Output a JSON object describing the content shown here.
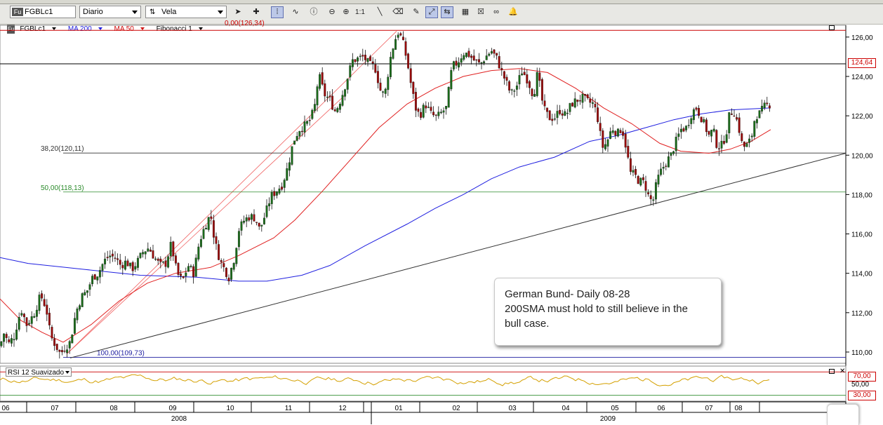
{
  "toolbar": {
    "symbol": "FGBLc1",
    "symbol_badge": "Fu",
    "interval": "Diario",
    "chart_type": "Vela",
    "ratio_label": "1:1"
  },
  "legend": {
    "symbol": "FGBLc1",
    "ma200": "MA 200",
    "ma50": "MA 50",
    "fib": "Fibonacci 1"
  },
  "price_axis": {
    "labels": [
      "126,00",
      "124,00",
      "122,00",
      "120,00",
      "118,00",
      "116,00",
      "114,00",
      "112,00",
      "110,00"
    ],
    "current_price": "124,64"
  },
  "fibonacci": {
    "l382": "38,20(120,11)",
    "l50": "50,00(118,13)",
    "l100": "100,00(109,73)",
    "l0_partial": "0,00(126,34)"
  },
  "rsi": {
    "label": "RSI 12 Suavizado",
    "upper": "70,00",
    "middle": "50,00",
    "lower": "30,00"
  },
  "time_axis": {
    "months": [
      "06",
      "07",
      "08",
      "09",
      "10",
      "11",
      "12",
      "01",
      "02",
      "03",
      "04",
      "05",
      "06",
      "07",
      "08"
    ],
    "years": [
      "2008",
      "2009"
    ]
  },
  "annotation": {
    "line1": "German Bund- Daily 08-28",
    "line2": "200SMA must hold to still believe in the",
    "line3": "bull case."
  },
  "colors": {
    "ma200": "#1f1fe0",
    "ma50": "#e02020",
    "rsi": "#d4a000",
    "up_candle": "#1a6b1a",
    "down_candle": "#9a0a0a"
  },
  "chart_data": {
    "type": "candlestick",
    "y_axis": {
      "range": [
        109.5,
        126.6
      ],
      "ticks": [
        110,
        112,
        114,
        116,
        118,
        120,
        122,
        124,
        126
      ]
    },
    "x_axis": {
      "months": [
        "06",
        "07",
        "08",
        "09",
        "10",
        "11",
        "12",
        "01",
        "02",
        "03",
        "04",
        "05",
        "06",
        "07",
        "08"
      ],
      "years": [
        "2008",
        "2009"
      ]
    },
    "close_path": [
      [
        0,
        110.3
      ],
      [
        6,
        111.0
      ],
      [
        12,
        110.4
      ],
      [
        20,
        110.8
      ],
      [
        30,
        112.2
      ],
      [
        38,
        111.4
      ],
      [
        48,
        111.9
      ],
      [
        58,
        112.9
      ],
      [
        66,
        112.2
      ],
      [
        72,
        110.8
      ],
      [
        80,
        110.3
      ],
      [
        86,
        109.9
      ],
      [
        92,
        110.2
      ],
      [
        100,
        110.5
      ],
      [
        108,
        112.0
      ],
      [
        116,
        112.8
      ],
      [
        124,
        113.1
      ],
      [
        132,
        113.8
      ],
      [
        140,
        114.0
      ],
      [
        148,
        114.6
      ],
      [
        156,
        114.9
      ],
      [
        164,
        114.8
      ],
      [
        172,
        114.4
      ],
      [
        180,
        114.6
      ],
      [
        188,
        114.2
      ],
      [
        196,
        114.6
      ],
      [
        204,
        115.1
      ],
      [
        212,
        115.3
      ],
      [
        220,
        114.8
      ],
      [
        228,
        114.4
      ],
      [
        236,
        114.5
      ],
      [
        244,
        115.5
      ],
      [
        252,
        114.0
      ],
      [
        260,
        113.6
      ],
      [
        268,
        114.4
      ],
      [
        276,
        114.0
      ],
      [
        284,
        115.6
      ],
      [
        292,
        116.4
      ],
      [
        300,
        117.0
      ],
      [
        306,
        115.6
      ],
      [
        314,
        114.6
      ],
      [
        320,
        114.2
      ],
      [
        326,
        113.8
      ],
      [
        334,
        114.8
      ],
      [
        340,
        116.2
      ],
      [
        348,
        116.7
      ],
      [
        356,
        116.9
      ],
      [
        364,
        116.8
      ],
      [
        370,
        116.2
      ],
      [
        378,
        117.0
      ],
      [
        386,
        117.9
      ],
      [
        394,
        118.2
      ],
      [
        402,
        118.5
      ],
      [
        410,
        119.4
      ],
      [
        418,
        120.7
      ],
      [
        426,
        121.3
      ],
      [
        434,
        121.5
      ],
      [
        442,
        121.8
      ],
      [
        448,
        122.4
      ],
      [
        454,
        124.1
      ],
      [
        462,
        123.1
      ],
      [
        470,
        122.8
      ],
      [
        478,
        122.2
      ],
      [
        486,
        122.9
      ],
      [
        494,
        123.8
      ],
      [
        502,
        124.8
      ],
      [
        510,
        124.9
      ],
      [
        518,
        125.0
      ],
      [
        526,
        124.6
      ],
      [
        534,
        124.5
      ],
      [
        542,
        123.3
      ],
      [
        548,
        123.0
      ],
      [
        556,
        124.9
      ],
      [
        562,
        125.8
      ],
      [
        568,
        126.3
      ],
      [
        574,
        125.7
      ],
      [
        580,
        124.8
      ],
      [
        586,
        123.5
      ],
      [
        592,
        122.4
      ],
      [
        598,
        122.0
      ],
      [
        606,
        122.6
      ],
      [
        614,
        122.1
      ],
      [
        622,
        121.9
      ],
      [
        630,
        122.2
      ],
      [
        636,
        122.4
      ],
      [
        644,
        124.5
      ],
      [
        652,
        124.7
      ],
      [
        660,
        125.2
      ],
      [
        668,
        125.1
      ],
      [
        676,
        124.8
      ],
      [
        684,
        124.6
      ],
      [
        692,
        125.0
      ],
      [
        700,
        125.3
      ],
      [
        708,
        124.9
      ],
      [
        714,
        124.3
      ],
      [
        720,
        123.8
      ],
      [
        728,
        123.1
      ],
      [
        736,
        123.5
      ],
      [
        744,
        124.3
      ],
      [
        752,
        123.8
      ],
      [
        760,
        123.0
      ],
      [
        766,
        124.2
      ],
      [
        774,
        122.4
      ],
      [
        782,
        121.9
      ],
      [
        790,
        121.9
      ],
      [
        798,
        122.3
      ],
      [
        806,
        122.0
      ],
      [
        814,
        122.6
      ],
      [
        822,
        122.8
      ],
      [
        830,
        122.9
      ],
      [
        838,
        122.7
      ],
      [
        846,
        122.6
      ],
      [
        852,
        121.8
      ],
      [
        858,
        120.4
      ],
      [
        864,
        120.6
      ],
      [
        872,
        121.4
      ],
      [
        880,
        121.1
      ],
      [
        886,
        121.4
      ],
      [
        892,
        120.4
      ],
      [
        898,
        119.1
      ],
      [
        904,
        119.0
      ],
      [
        910,
        118.7
      ],
      [
        918,
        118.6
      ],
      [
        924,
        117.9
      ],
      [
        930,
        117.6
      ],
      [
        936,
        118.7
      ],
      [
        942,
        119.2
      ],
      [
        948,
        119.6
      ],
      [
        956,
        120.0
      ],
      [
        962,
        120.6
      ],
      [
        970,
        121.3
      ],
      [
        978,
        121.4
      ],
      [
        986,
        122.2
      ],
      [
        992,
        122.4
      ],
      [
        998,
        122.0
      ],
      [
        1004,
        121.5
      ],
      [
        1010,
        121.0
      ],
      [
        1016,
        121.3
      ],
      [
        1022,
        120.4
      ],
      [
        1028,
        120.5
      ],
      [
        1034,
        121.0
      ],
      [
        1040,
        122.2
      ],
      [
        1046,
        122.2
      ],
      [
        1052,
        121.5
      ],
      [
        1058,
        120.4
      ],
      [
        1064,
        120.5
      ],
      [
        1070,
        120.8
      ],
      [
        1076,
        122.0
      ],
      [
        1082,
        122.1
      ],
      [
        1090,
        122.5
      ],
      [
        1098,
        122.6
      ]
    ],
    "ma200_path": [
      [
        0,
        114.8
      ],
      [
        40,
        114.5
      ],
      [
        120,
        114.2
      ],
      [
        200,
        113.9
      ],
      [
        280,
        113.8
      ],
      [
        340,
        113.6
      ],
      [
        380,
        113.6
      ],
      [
        430,
        113.9
      ],
      [
        470,
        114.4
      ],
      [
        520,
        115.4
      ],
      [
        580,
        116.5
      ],
      [
        620,
        117.3
      ],
      [
        660,
        118.0
      ],
      [
        700,
        118.8
      ],
      [
        740,
        119.4
      ],
      [
        790,
        119.9
      ],
      [
        840,
        120.7
      ],
      [
        880,
        121.0
      ],
      [
        920,
        121.4
      ],
      [
        960,
        121.8
      ],
      [
        1000,
        122.1
      ],
      [
        1040,
        122.3
      ],
      [
        1098,
        122.4
      ]
    ],
    "ma50_path": [
      [
        0,
        112.7
      ],
      [
        30,
        111.6
      ],
      [
        60,
        111.0
      ],
      [
        90,
        110.5
      ],
      [
        130,
        111.4
      ],
      [
        170,
        112.6
      ],
      [
        210,
        113.5
      ],
      [
        250,
        114.0
      ],
      [
        300,
        114.3
      ],
      [
        340,
        114.9
      ],
      [
        390,
        115.8
      ],
      [
        420,
        116.7
      ],
      [
        460,
        118.2
      ],
      [
        500,
        119.8
      ],
      [
        540,
        121.4
      ],
      [
        580,
        122.6
      ],
      [
        620,
        123.4
      ],
      [
        660,
        124.0
      ],
      [
        700,
        124.3
      ],
      [
        740,
        124.4
      ],
      [
        780,
        124.2
      ],
      [
        820,
        123.4
      ],
      [
        860,
        122.4
      ],
      [
        900,
        121.6
      ],
      [
        940,
        120.6
      ],
      [
        970,
        120.2
      ],
      [
        1010,
        120.1
      ],
      [
        1040,
        120.3
      ],
      [
        1070,
        120.7
      ],
      [
        1098,
        121.3
      ]
    ],
    "fib_high_line": {
      "y": 126.34
    },
    "current_price_line": {
      "y": 124.64
    },
    "fib_levels": [
      {
        "label": "38,20(120,11)",
        "y": 120.11
      },
      {
        "label": "50,00(118,13)",
        "y": 118.13
      },
      {
        "label": "100,00(109,73)",
        "y": 109.73
      }
    ],
    "trendline": [
      [
        100,
        109.7
      ],
      [
        1205,
        120.1
      ]
    ],
    "fib_fan": [
      [
        [
          95,
          109.9
        ],
        [
          565,
          126.3
        ]
      ],
      [
        [
          95,
          109.9
        ],
        [
          490,
          123.0
        ]
      ]
    ],
    "rsi": {
      "range": [
        20,
        80
      ],
      "levels": [
        30,
        50,
        70
      ]
    }
  }
}
